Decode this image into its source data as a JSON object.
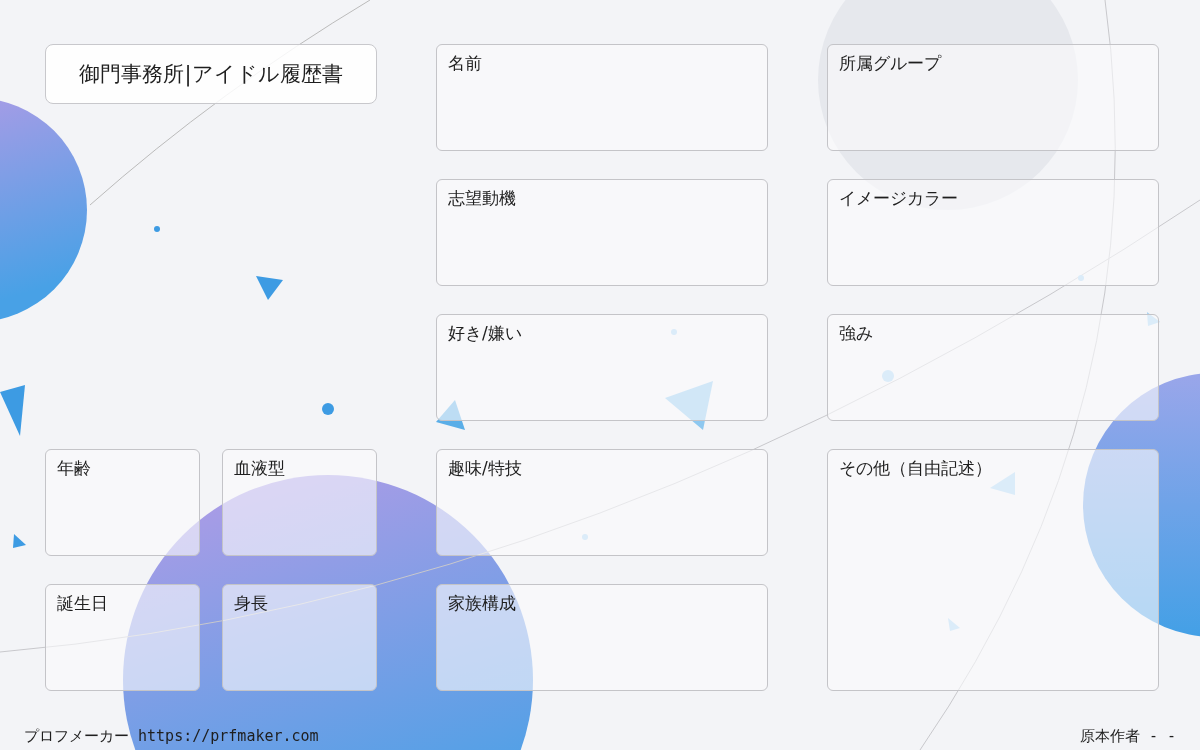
{
  "title": "御門事務所|アイドル履歴書",
  "left_fields": [
    {
      "label": "年齢"
    },
    {
      "label": "血液型"
    },
    {
      "label": "誕生日"
    },
    {
      "label": "身長"
    }
  ],
  "middle_fields": [
    {
      "label": "名前"
    },
    {
      "label": "志望動機"
    },
    {
      "label": "好き/嫌い"
    },
    {
      "label": "趣味/特技"
    },
    {
      "label": "家族構成"
    }
  ],
  "right_fields": [
    {
      "label": "所属グループ"
    },
    {
      "label": "イメージカラー"
    },
    {
      "label": "強み"
    },
    {
      "label": "その他（自由記述）"
    }
  ],
  "footer": {
    "site": "プロフメーカー https://prfmaker.com",
    "author": "原本作者 - -"
  }
}
